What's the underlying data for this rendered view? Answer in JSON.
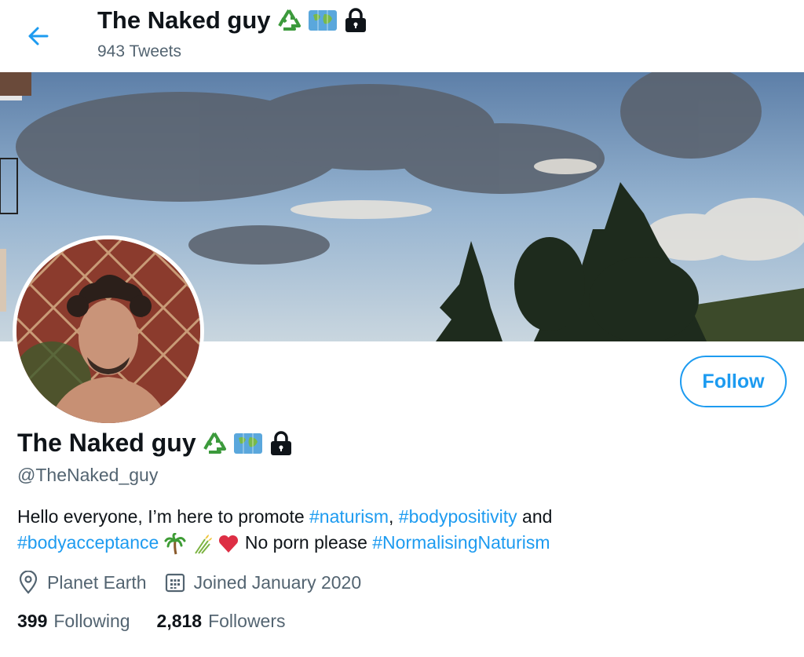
{
  "header": {
    "back_icon": "arrow-left-icon",
    "title": "The Naked guy",
    "tweet_count": "943 Tweets",
    "title_emojis": [
      "recycle-icon",
      "world-map-icon",
      "padlock-icon"
    ]
  },
  "profile": {
    "display_name": "The Naked guy",
    "handle": "@TheNaked_guy",
    "follow_label": "Follow",
    "bio": {
      "t1": "Hello everyone, I’m here to promote ",
      "tag1": "#naturism",
      "t2": ", ",
      "tag2": "#bodypositivity",
      "t3": " and",
      "tag3": "#bodyacceptance",
      "t4": " No porn please ",
      "tag4": "#NormalisingNaturism",
      "emojis": [
        "palm-tree-icon",
        "sheaf-of-rice-icon",
        "red-heart-icon"
      ]
    },
    "location": "Planet Earth",
    "joined": "Joined January 2020",
    "following_count": "399",
    "following_label": "Following",
    "followers_count": "2,818",
    "followers_label": "Followers"
  },
  "colors": {
    "accent": "#1d9bf0",
    "text": "#0f1419",
    "secondary": "#536471"
  }
}
